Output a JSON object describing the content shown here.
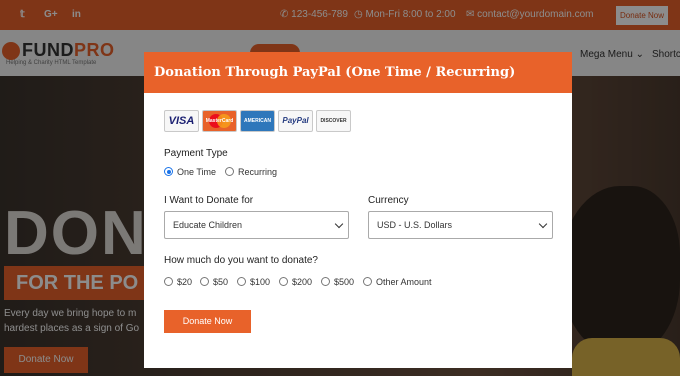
{
  "topbar": {
    "social": [
      "t",
      "G+",
      "in"
    ],
    "phone": "123-456-789",
    "hours": "Mon-Fri 8:00 to 2:00",
    "email": "contact@yourdomain.com",
    "donate_label": "Donate Now"
  },
  "logo": {
    "name_a": "FUND",
    "name_b": "PRO",
    "tagline": "Helping & Charity HTML Template"
  },
  "nav": {
    "items": [
      "Mega Menu ⌄",
      "Shortc"
    ]
  },
  "hero": {
    "big_text": "DON",
    "band_text": "FOR THE PO",
    "line1": "Every day we bring hope to m",
    "line2": "hardest places as a sign of Go",
    "button": "Donate Now"
  },
  "modal": {
    "title": "Donation Through PayPal (One Time / Recurring)",
    "cards": [
      "VISA",
      "MasterCard",
      "AMERICAN EXPRESS",
      "PayPal",
      "DISCOVER"
    ],
    "payment_type_label": "Payment Type",
    "payment_types": [
      "One Time",
      "Recurring"
    ],
    "selected_payment_type": "One Time",
    "donate_for_label": "I Want to Donate for",
    "donate_for_value": "Educate Children",
    "currency_label": "Currency",
    "currency_value": "USD - U.S. Dollars",
    "amount_label": "How much do you want to donate?",
    "amounts": [
      "$20",
      "$50",
      "$100",
      "$200",
      "$500",
      "Other Amount"
    ],
    "submit_label": "Donate Now"
  },
  "colors": {
    "accent": "#e8622a",
    "radio_selected": "#1a73e8"
  }
}
